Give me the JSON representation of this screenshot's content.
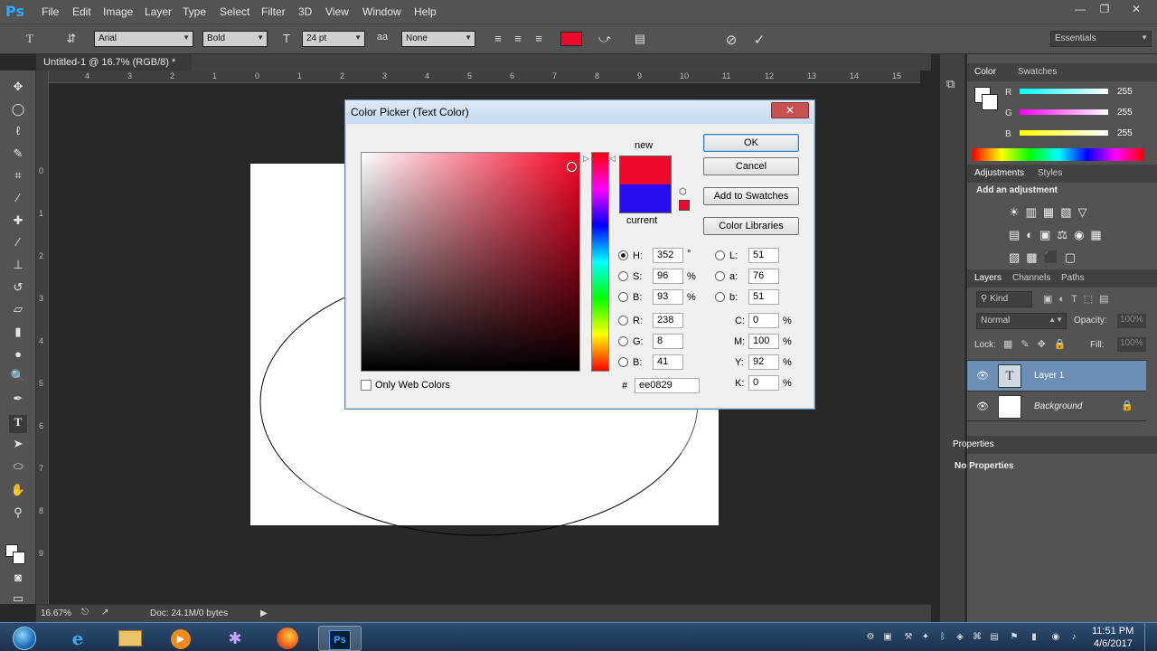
{
  "app": {
    "logo": "Ps"
  },
  "menu": [
    "File",
    "Edit",
    "Image",
    "Layer",
    "Type",
    "Select",
    "Filter",
    "3D",
    "View",
    "Window",
    "Help"
  ],
  "window_controls": {
    "minimize": "—",
    "restore": "❐",
    "close": "✕"
  },
  "options_bar": {
    "tool_glyph": "T",
    "font_family": "Arial",
    "font_style": "Bold",
    "font_size": "24 pt",
    "antialias": "None",
    "text_color": "#ee0829",
    "workspace": "Essentials"
  },
  "document": {
    "tab_title": "Untitled-1 @ 16.7% (RGB/8) *",
    "tab_close": "×",
    "ruler_top": [
      "4",
      "3",
      "2",
      "1",
      "0",
      "1",
      "2",
      "3",
      "4",
      "5",
      "6",
      "7",
      "8",
      "9",
      "10",
      "11",
      "12",
      "13",
      "14",
      "15"
    ],
    "ruler_left": [
      "0",
      "1",
      "2",
      "3",
      "4",
      "5",
      "6",
      "7",
      "8",
      "9"
    ]
  },
  "status": {
    "zoom": "16.67%",
    "doc_info": "Doc: 24.1M/0 bytes"
  },
  "tools": [
    "move-tool",
    "marquee-tool",
    "lasso-tool",
    "quick-select-tool",
    "crop-tool",
    "eyedropper-tool",
    "healing-tool",
    "brush-tool",
    "stamp-tool",
    "history-brush-tool",
    "eraser-tool",
    "gradient-tool",
    "blur-tool",
    "dodge-tool",
    "pen-tool",
    "type-tool",
    "path-select-tool",
    "ellipse-tool",
    "hand-tool",
    "zoom-tool"
  ],
  "color_panel": {
    "tabs": [
      "Color",
      "Swatches"
    ],
    "channels": [
      {
        "label": "R",
        "value": "255"
      },
      {
        "label": "G",
        "value": "255"
      },
      {
        "label": "B",
        "value": "255"
      }
    ]
  },
  "adjustments_panel": {
    "tabs": [
      "Adjustments",
      "Styles"
    ],
    "heading": "Add an adjustment"
  },
  "layers_panel": {
    "tabs": [
      "Layers",
      "Channels",
      "Paths"
    ],
    "filter": "Kind",
    "blend_mode": "Normal",
    "opacity_label": "Opacity:",
    "opacity_value": "100%",
    "lock_label": "Lock:",
    "fill_label": "Fill:",
    "fill_value": "100%",
    "layers": [
      {
        "name": "Layer 1",
        "thumb": "T"
      },
      {
        "name": "Background",
        "thumb": ""
      }
    ]
  },
  "properties_panel": {
    "tab": "Properties",
    "message": "No Properties"
  },
  "color_picker": {
    "title": "Color Picker (Text Color)",
    "close": "✕",
    "new_label": "new",
    "current_label": "current",
    "new_color": "#ee0829",
    "current_color": "#2a0cf0",
    "buttons": {
      "ok": "OK",
      "cancel": "Cancel",
      "add_to_swatches": "Add to Swatches",
      "color_libraries": "Color Libraries"
    },
    "hsb": [
      {
        "label": "H:",
        "value": "352",
        "unit": "°",
        "selected": true
      },
      {
        "label": "S:",
        "value": "96",
        "unit": "%",
        "selected": false
      },
      {
        "label": "B:",
        "value": "93",
        "unit": "%",
        "selected": false
      }
    ],
    "rgb": [
      {
        "label": "R:",
        "value": "238"
      },
      {
        "label": "G:",
        "value": "8"
      },
      {
        "label": "B:",
        "value": "41"
      }
    ],
    "lab": [
      {
        "label": "L:",
        "value": "51"
      },
      {
        "label": "a:",
        "value": "76"
      },
      {
        "label": "b:",
        "value": "51"
      }
    ],
    "cmyk": [
      {
        "label": "C:",
        "value": "0",
        "unit": "%"
      },
      {
        "label": "M:",
        "value": "100",
        "unit": "%"
      },
      {
        "label": "Y:",
        "value": "92",
        "unit": "%"
      },
      {
        "label": "K:",
        "value": "0",
        "unit": "%"
      }
    ],
    "hex_label": "#",
    "hex_value": "ee0829",
    "only_web_colors": "Only Web Colors"
  },
  "taskbar": {
    "apps": [
      "start-button",
      "internet-explorer",
      "file-explorer",
      "media-player",
      "app-icon",
      "firefox",
      "photoshop"
    ],
    "time": "11:51 PM",
    "date": "4/6/2017"
  }
}
